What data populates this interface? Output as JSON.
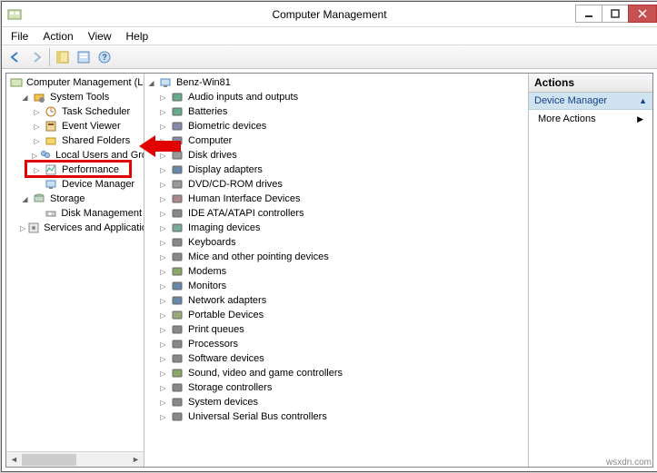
{
  "title": "Computer Management",
  "menubar": [
    "File",
    "Action",
    "View",
    "Help"
  ],
  "left_tree": {
    "root": "Computer Management (Local",
    "system_tools": {
      "label": "System Tools",
      "children": {
        "task_scheduler": "Task Scheduler",
        "event_viewer": "Event Viewer",
        "shared_folders": "Shared Folders",
        "local_users": "Local Users and Groups",
        "performance": "Performance",
        "device_manager": "Device Manager"
      }
    },
    "storage": {
      "label": "Storage",
      "children": {
        "disk_management": "Disk Management"
      }
    },
    "services": "Services and Applications"
  },
  "mid_tree": {
    "root": "Benz-Win81",
    "items": [
      "Audio inputs and outputs",
      "Batteries",
      "Biometric devices",
      "Computer",
      "Disk drives",
      "Display adapters",
      "DVD/CD-ROM drives",
      "Human Interface Devices",
      "IDE ATA/ATAPI controllers",
      "Imaging devices",
      "Keyboards",
      "Mice and other pointing devices",
      "Modems",
      "Monitors",
      "Network adapters",
      "Portable Devices",
      "Print queues",
      "Processors",
      "Software devices",
      "Sound, video and game controllers",
      "Storage controllers",
      "System devices",
      "Universal Serial Bus controllers"
    ]
  },
  "actions": {
    "header": "Actions",
    "section_title": "Device Manager",
    "more": "More Actions"
  },
  "watermark": "wsxdn.com"
}
